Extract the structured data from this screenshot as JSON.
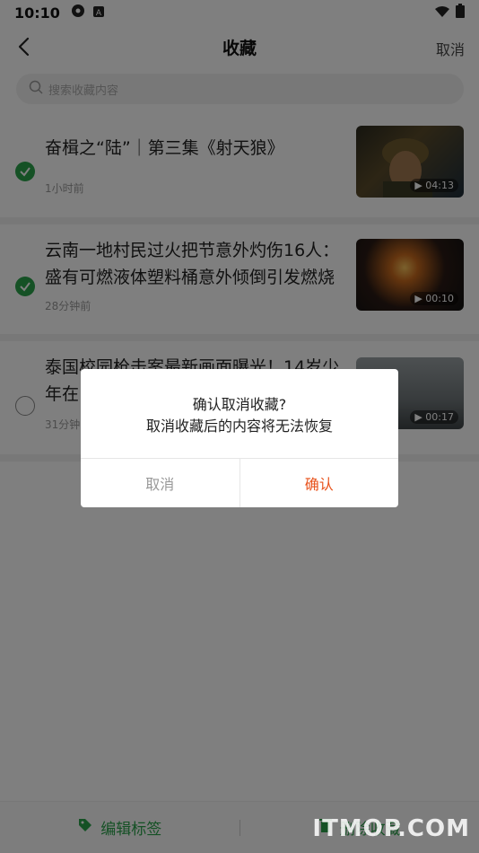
{
  "status_bar": {
    "time": "10:10"
  },
  "nav": {
    "title": "收藏",
    "cancel_label": "取消"
  },
  "search": {
    "placeholder": "搜索收藏内容"
  },
  "items": [
    {
      "title": "奋楫之“陆”｜第三集《射天狼》",
      "meta": "1小时前",
      "duration": "04:13",
      "checked": true
    },
    {
      "title": "云南一地村民过火把节意外灼伤16人：盛有可燃液体塑料桶意外倾倒引发燃烧",
      "meta": "28分钟前",
      "duration": "00:10",
      "checked": true
    },
    {
      "title": "泰国校园枪击案最新画面曝光！14岁少年在",
      "meta": "31分钟",
      "duration": "00:17",
      "checked": false
    }
  ],
  "bottom_bar": {
    "edit_tags_label": "编辑标签",
    "delete_label": "删除收藏"
  },
  "dialog": {
    "line1": "确认取消收藏?",
    "line2": "取消收藏后的内容将无法恢复",
    "cancel_label": "取消",
    "confirm_label": "确认"
  },
  "watermark": "ITMOP.COM",
  "colors": {
    "accent_green": "#2aa24b",
    "confirm_orange": "#e8521b"
  }
}
